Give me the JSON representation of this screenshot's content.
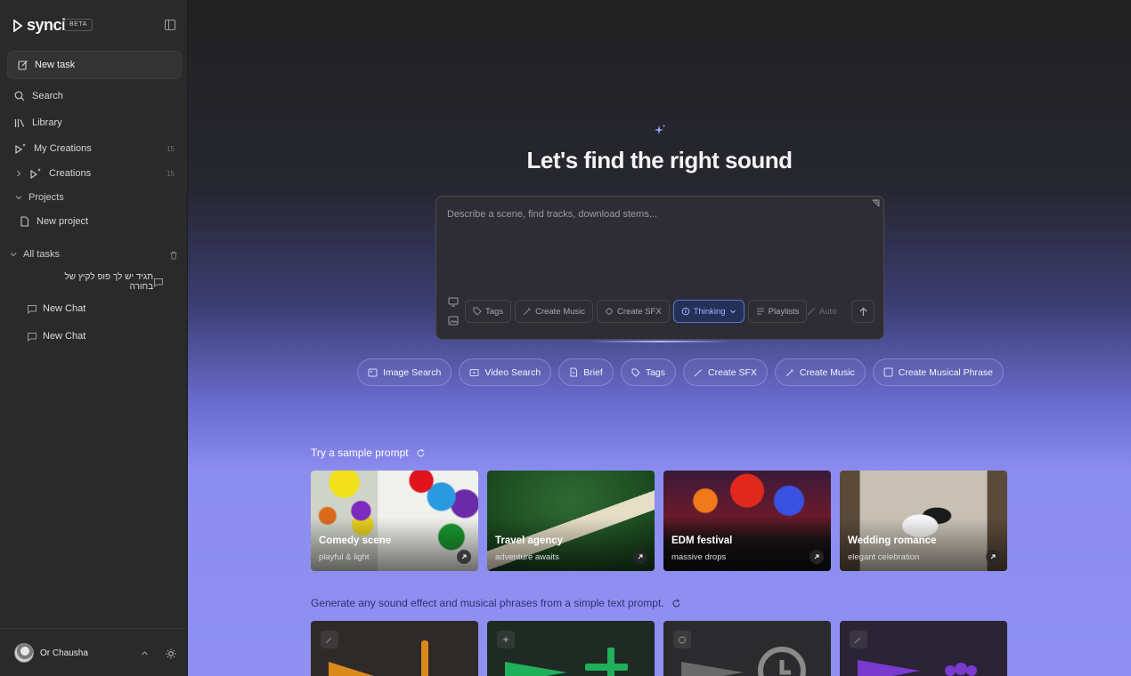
{
  "app": {
    "name": "synci",
    "badge": "BETA"
  },
  "sidebar": {
    "new_task": "New task",
    "search": "Search",
    "library": "Library",
    "my_creations": {
      "label": "My Creations",
      "count": "15"
    },
    "creations": {
      "label": "Creations",
      "count": "15"
    },
    "projects": "Projects",
    "new_project": "New project",
    "all_tasks": "All tasks",
    "tasks": [
      "תגיד יש לך פופ לקיץ של בחורה",
      "New Chat",
      "New Chat"
    ],
    "user": {
      "name": "Or Chausha"
    }
  },
  "main": {
    "title": "Let's find the right sound",
    "composer": {
      "placeholder": "Describe a scene, find tracks, download stems...",
      "tools": [
        "Tags",
        "Create Music",
        "Create SFX",
        "Thinking",
        "Playlists"
      ],
      "auto": "Auto"
    },
    "quick_actions": [
      "Image Search",
      "Video Search",
      "Brief",
      "Tags",
      "Create SFX",
      "Create Music",
      "Create Musical Phrase"
    ],
    "sample_title": "Try a sample prompt",
    "samples": [
      {
        "title": "Comedy scene",
        "subtitle": "playful & light"
      },
      {
        "title": "Travel agency",
        "subtitle": "adventure awaits"
      },
      {
        "title": "EDM festival",
        "subtitle": "massive drops"
      },
      {
        "title": "Wedding romance",
        "subtitle": "elegant celebration"
      }
    ],
    "generate_title": "Generate any sound effect and musical phrases from a simple text prompt."
  },
  "colors": {
    "accent": "#5c74d8",
    "sfx_orange": "#d98a1a",
    "sfx_green": "#1fb05a",
    "sfx_gray": "#8a8a8a",
    "sfx_purple": "#7a3ad0"
  }
}
